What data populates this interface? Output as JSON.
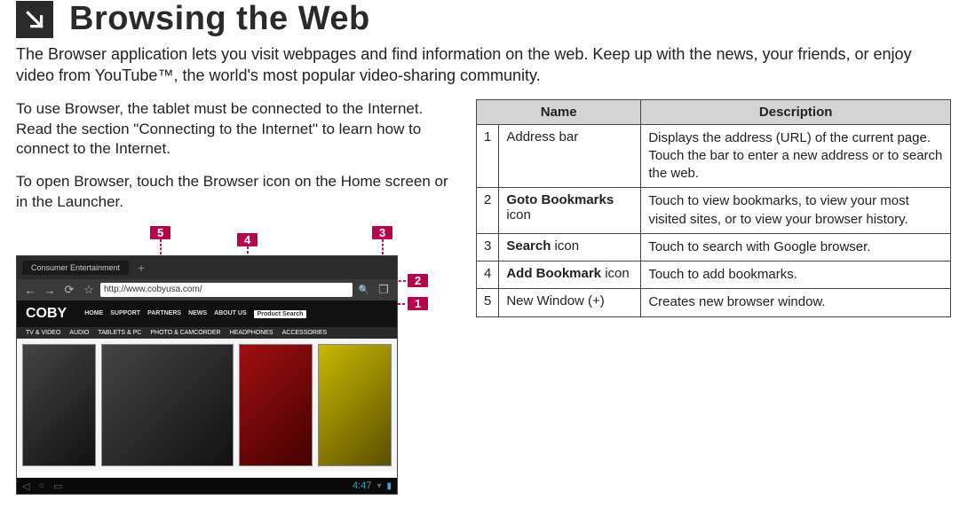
{
  "header": {
    "title": "Browsing the Web"
  },
  "intro": "The Browser application lets you visit webpages and find information on the web. Keep up with the news, your friends, or enjoy video from YouTube™, the world's most popular video-sharing community.",
  "left": {
    "p1": "To use Browser, the tablet must be connected to the Internet. Read the section \"Connecting to the Internet\" to learn how to connect to the Internet.",
    "p2": "To open Browser, touch the Browser icon on the Home screen or in the Launcher."
  },
  "callouts": {
    "c1": "1",
    "c2": "2",
    "c3": "3",
    "c4": "4",
    "c5": "5"
  },
  "screenshot": {
    "tab_label": "Consumer Entertainment",
    "plus": "+",
    "url": "http://www.cobyusa.com/",
    "logo": "COBY",
    "menu": {
      "m1": "HOME",
      "m2": "SUPPORT",
      "m3": "PARTNERS",
      "m4": "NEWS",
      "m5": "ABOUT US",
      "ps": "Product Search"
    },
    "categories": {
      "c1": "TV & VIDEO",
      "c2": "AUDIO",
      "c3": "TABLETS & PC",
      "c4": "PHOTO & CAMCORDER",
      "c5": "HEADPHONES",
      "c6": "ACCESSORIES"
    },
    "clock": "4:47"
  },
  "table": {
    "headers": {
      "name": "Name",
      "desc": "Description"
    },
    "rows": [
      {
        "num": "1",
        "name": "Address bar",
        "name_bold": false,
        "desc": "Displays the address (URL) of the current page. Touch the bar to enter a new address or to search the web."
      },
      {
        "num": "2",
        "name_pre": "Goto Bookmarks",
        "name_post": " icon",
        "name_bold": true,
        "desc": "Touch to view bookmarks, to view your most visited sites, or to view your browser history."
      },
      {
        "num": "3",
        "name_pre": "Search",
        "name_post": " icon",
        "name_bold": true,
        "desc": "Touch to search with Google browser."
      },
      {
        "num": "4",
        "name_pre": "Add Bookmark",
        "name_post": " icon",
        "name_bold": true,
        "desc": "Touch to add bookmarks."
      },
      {
        "num": "5",
        "name": "New Window (+)",
        "name_bold": false,
        "desc": "Creates new browser window."
      }
    ]
  }
}
